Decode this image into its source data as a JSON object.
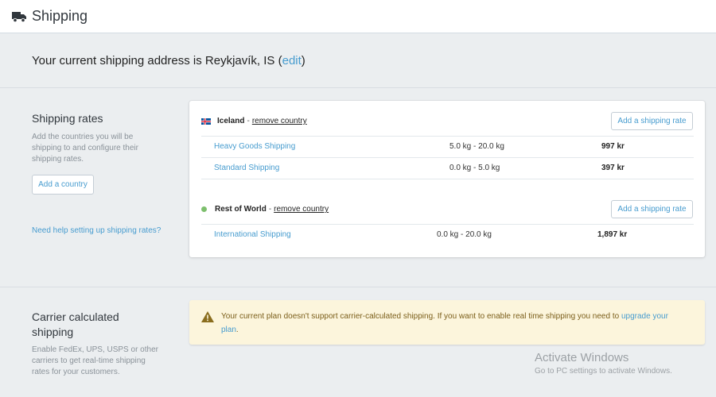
{
  "header": {
    "title": "Shipping",
    "icon": "truck-icon"
  },
  "address": {
    "text": "Your current shipping address is Reykjavík, IS",
    "open_paren": " (",
    "edit_label": "edit",
    "close_paren": ")"
  },
  "shipping_rates": {
    "title": "Shipping rates",
    "description": "Add the countries you will be shipping to and configure their shipping rates.",
    "add_country_label": "Add a country",
    "help_link": "Need help setting up shipping rates?",
    "zones": [
      {
        "name": "Iceland",
        "separator": "-",
        "remove_label": "remove country",
        "add_rate_label": "Add a shipping rate",
        "rates": [
          {
            "name": "Heavy Goods Shipping",
            "weight": "5.0 kg - 20.0 kg",
            "price": "997 kr"
          },
          {
            "name": "Standard Shipping",
            "weight": "0.0 kg - 5.0 kg",
            "price": "397 kr"
          }
        ]
      },
      {
        "name": "Rest of World",
        "separator": "-",
        "remove_label": "remove country",
        "add_rate_label": "Add a shipping rate",
        "rates": [
          {
            "name": "International Shipping",
            "weight": "0.0 kg - 20.0 kg",
            "price": "1,897 kr"
          }
        ]
      }
    ]
  },
  "carrier": {
    "title_line1": "Carrier calculated",
    "title_line2": "shipping",
    "description": "Enable FedEx, UPS, USPS or other carriers to get real-time shipping rates for your customers.",
    "notice_text": "Your current plan doesn't support carrier-calculated shipping. If you want to enable real time shipping you need to",
    "notice_link": "upgrade your plan",
    "notice_end": "."
  },
  "watermark": {
    "line1": "Activate Windows",
    "line2": "Go to PC settings to activate Windows."
  },
  "colors": {
    "background": "#ebeef0",
    "link": "#479ccf",
    "notice_bg": "#fcf5dc",
    "warning_icon": "#8a6d1e",
    "iceland_flag_blue": "#02529c",
    "iceland_flag_red": "#dc1e35",
    "rest_of_world_dot": "#7dbf6d"
  }
}
